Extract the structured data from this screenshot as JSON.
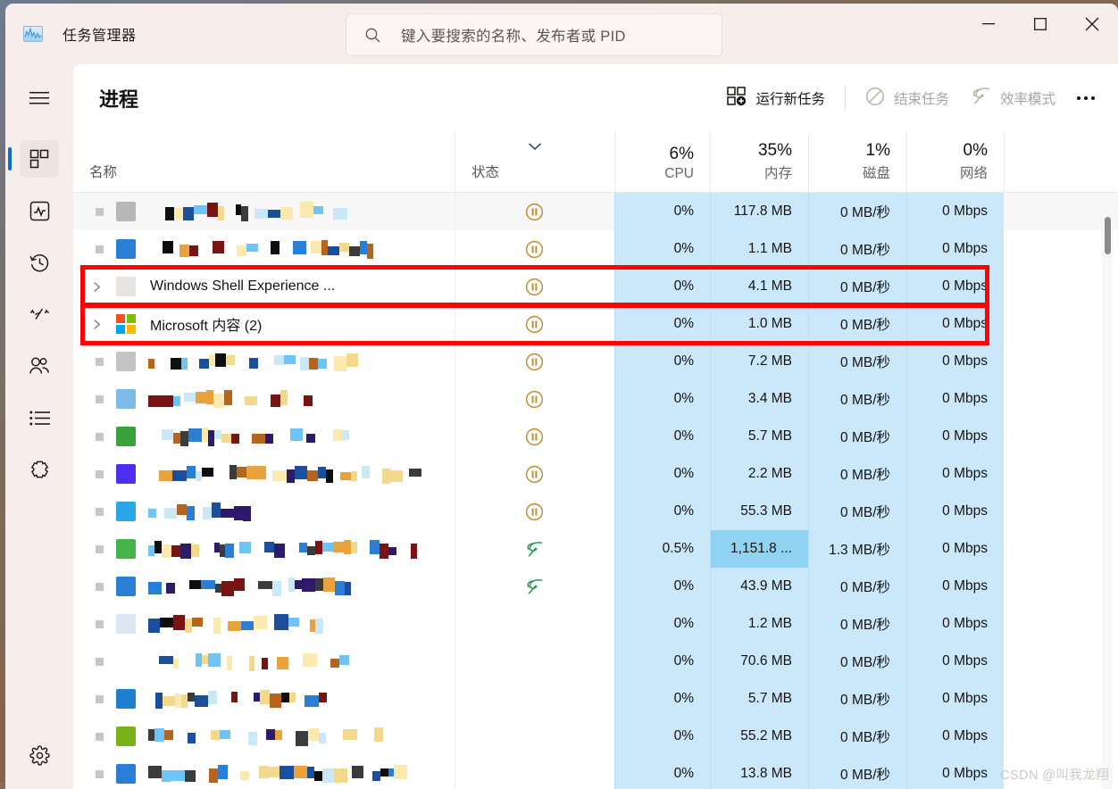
{
  "window": {
    "app_icon": "chart-icon",
    "title": "任务管理器",
    "controls": {
      "minimize": "minimize-icon",
      "maximize": "maximize-icon",
      "close": "close-icon"
    }
  },
  "search": {
    "icon": "search-icon",
    "placeholder": "键入要搜索的名称、发布者或 PID",
    "value": ""
  },
  "sidebar": {
    "menu_icon": "hamburger-icon",
    "items": [
      {
        "name": "processes",
        "icon": "processes-icon",
        "selected": true
      },
      {
        "name": "performance",
        "icon": "performance-icon",
        "selected": false
      },
      {
        "name": "app-history",
        "icon": "history-icon",
        "selected": false
      },
      {
        "name": "startup-apps",
        "icon": "gauge-icon",
        "selected": false
      },
      {
        "name": "users",
        "icon": "users-icon",
        "selected": false
      },
      {
        "name": "details",
        "icon": "list-icon",
        "selected": false
      },
      {
        "name": "services",
        "icon": "services-icon",
        "selected": false
      }
    ],
    "settings": {
      "name": "settings",
      "icon": "gear-icon"
    }
  },
  "page": {
    "title": "进程",
    "toolbar": {
      "run_new_task": {
        "label": "运行新任务",
        "icon": "new-task-icon",
        "disabled": false
      },
      "end_task": {
        "label": "结束任务",
        "icon": "prohibit-icon",
        "disabled": true
      },
      "efficiency_mode": {
        "label": "效率模式",
        "icon": "leaf-icon",
        "disabled": true
      },
      "more": {
        "label": "…",
        "icon": "more-dots-icon"
      }
    }
  },
  "table": {
    "columns": [
      {
        "key": "name",
        "label": "名称",
        "pct": "",
        "align": "left"
      },
      {
        "key": "status",
        "label": "状态",
        "pct": "",
        "align": "left",
        "sorted": true
      },
      {
        "key": "cpu",
        "label": "CPU",
        "pct": "6%",
        "align": "right"
      },
      {
        "key": "mem",
        "label": "内存",
        "pct": "35%",
        "align": "right"
      },
      {
        "key": "disk",
        "label": "磁盘",
        "pct": "1%",
        "align": "right"
      },
      {
        "key": "net",
        "label": "网络",
        "pct": "0%",
        "align": "right"
      }
    ],
    "rows": [
      {
        "name": "",
        "censored": true,
        "expandable": false,
        "status": "suspended",
        "cpu": "0%",
        "mem": "117.8 MB",
        "disk": "0 MB/秒",
        "net": "0 Mbps",
        "alt": true,
        "icon_color": "#b7b7b7"
      },
      {
        "name": "",
        "censored": true,
        "expandable": false,
        "status": "suspended",
        "cpu": "0%",
        "mem": "1.1 MB",
        "disk": "0 MB/秒",
        "net": "0 Mbps",
        "alt": false,
        "icon_color": "#2a7fd4"
      },
      {
        "name": "Windows Shell Experience ...",
        "censored": false,
        "expandable": true,
        "status": "suspended",
        "cpu": "0%",
        "mem": "4.1 MB",
        "disk": "0 MB/秒",
        "net": "0 Mbps",
        "alt": false,
        "highlight": true,
        "icon_color": "#e8e4e2"
      },
      {
        "name": "Microsoft 内容 (2)",
        "censored": false,
        "expandable": true,
        "status": "suspended",
        "cpu": "0%",
        "mem": "1.0 MB",
        "disk": "0 MB/秒",
        "net": "0 Mbps",
        "alt": false,
        "highlight": true,
        "icon_color": "ms-logo"
      },
      {
        "name": "",
        "censored": true,
        "expandable": false,
        "status": "suspended",
        "cpu": "0%",
        "mem": "7.2 MB",
        "disk": "0 MB/秒",
        "net": "0 Mbps",
        "alt": false,
        "icon_color": "#c4c4c4"
      },
      {
        "name": "",
        "censored": true,
        "expandable": false,
        "status": "suspended",
        "cpu": "0%",
        "mem": "3.4 MB",
        "disk": "0 MB/秒",
        "net": "0 Mbps",
        "alt": false,
        "icon_color": "#7fbbe8"
      },
      {
        "name": "",
        "censored": true,
        "expandable": false,
        "status": "suspended",
        "cpu": "0%",
        "mem": "5.7 MB",
        "disk": "0 MB/秒",
        "net": "0 Mbps",
        "alt": false,
        "icon_color": "#3aa23a"
      },
      {
        "name": "",
        "censored": true,
        "expandable": false,
        "status": "suspended",
        "cpu": "0%",
        "mem": "2.2 MB",
        "disk": "0 MB/秒",
        "net": "0 Mbps",
        "alt": false,
        "icon_color": "#4b2ef0"
      },
      {
        "name": "",
        "censored": true,
        "expandable": false,
        "status": "suspended",
        "cpu": "0%",
        "mem": "55.3 MB",
        "disk": "0 MB/秒",
        "net": "0 Mbps",
        "alt": false,
        "icon_color": "#2aa6e8"
      },
      {
        "name": "",
        "censored": true,
        "expandable": false,
        "status": "efficiency",
        "cpu": "0.5%",
        "mem": "1,151.8 ...",
        "disk": "1.3 MB/秒",
        "net": "0 Mbps",
        "alt": false,
        "mem_selected": true,
        "icon_color": "#43b54a"
      },
      {
        "name": "",
        "censored": true,
        "expandable": false,
        "status": "efficiency",
        "cpu": "0%",
        "mem": "43.9 MB",
        "disk": "0 MB/秒",
        "net": "0 Mbps",
        "alt": false,
        "icon_color": "#2a7fd4"
      },
      {
        "name": "",
        "censored": true,
        "expandable": false,
        "status": "none",
        "cpu": "0%",
        "mem": "1.2 MB",
        "disk": "0 MB/秒",
        "net": "0 Mbps",
        "alt": false,
        "icon_color": "#dce7f2"
      },
      {
        "name": "",
        "censored": true,
        "expandable": false,
        "status": "none",
        "cpu": "0%",
        "mem": "70.6 MB",
        "disk": "0 MB/秒",
        "net": "0 Mbps",
        "alt": false,
        "icon_color": ""
      },
      {
        "name": "",
        "censored": true,
        "expandable": false,
        "status": "none",
        "cpu": "0%",
        "mem": "5.7 MB",
        "disk": "0 MB/秒",
        "net": "0 Mbps",
        "alt": false,
        "icon_color": "#1e7fd0"
      },
      {
        "name": "",
        "censored": true,
        "expandable": false,
        "status": "none",
        "cpu": "0%",
        "mem": "55.2 MB",
        "disk": "0 MB/秒",
        "net": "0 Mbps",
        "alt": false,
        "icon_color": "#78b216"
      },
      {
        "name": "",
        "censored": true,
        "expandable": false,
        "status": "none",
        "cpu": "0%",
        "mem": "13.8 MB",
        "disk": "0 MB/秒",
        "net": "0 Mbps",
        "alt": false,
        "icon_color": "#2a7fd4"
      }
    ]
  },
  "scrollbar": {
    "name": "vertical-scrollbar"
  },
  "watermark": "CSDN @叫我龙翔",
  "colors": {
    "accent": "#0d6ec9",
    "annotation_red": "#fc0404",
    "row_tint": "#cbe8fa",
    "cell_selected": "#8fd2f2",
    "titlebar_bg": "#f7eeec",
    "status_suspended": "#c08a2a",
    "status_efficiency": "#1f9a4a"
  }
}
